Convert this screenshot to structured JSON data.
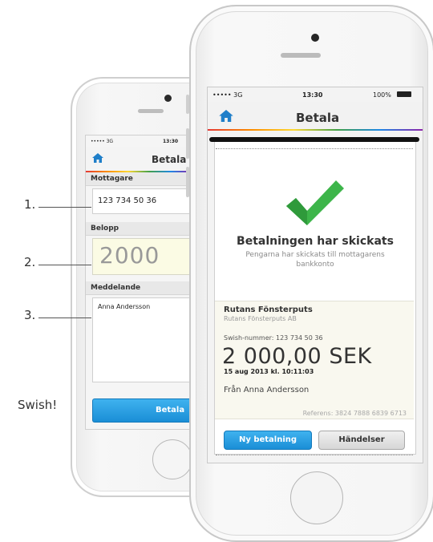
{
  "back_phone": {
    "status": {
      "carrier": "••••• 3G",
      "time": "13:30"
    },
    "nav": {
      "title": "Betala",
      "home_icon": "home-icon"
    },
    "recipient_label": "Mottagare",
    "recipient_value": "123 734 50 36",
    "amount_label": "Belopp",
    "amount_value": "2000",
    "message_label": "Meddelande",
    "message_value": "Anna Andersson",
    "pay_button": "Betala"
  },
  "annotations": [
    "1.",
    "2.",
    "3."
  ],
  "swish_label": "Swish!",
  "front_phone": {
    "status": {
      "carrier": "••••• 3G",
      "time": "13:30",
      "battery": "100%"
    },
    "nav": {
      "title": "Betala",
      "home_icon": "home-icon"
    },
    "confirmation": {
      "icon": "checkmark-icon",
      "title": "Betalningen har skickats",
      "subtitle": "Pengarna har skickats till mottagarens bankkonto"
    },
    "receipt": {
      "payee_name": "Rutans Fönsterputs",
      "payee_org": "Rutans Fönsterputs AB",
      "swish_number": "Swish-nummer: 123 734 50 36",
      "amount": "2 000,00 SEK",
      "datetime": "15 aug 2013 kl. 10:11:03",
      "from": "Från Anna Andersson",
      "reference": "Referens: 3824 7888 6839 6713"
    },
    "buttons": {
      "new_payment": "Ny betalning",
      "events": "Händelser"
    }
  },
  "colors": {
    "accent_blue": "#1a8ed6",
    "check_green": "#3db54a",
    "amount_bg": "#fbfbe4"
  }
}
